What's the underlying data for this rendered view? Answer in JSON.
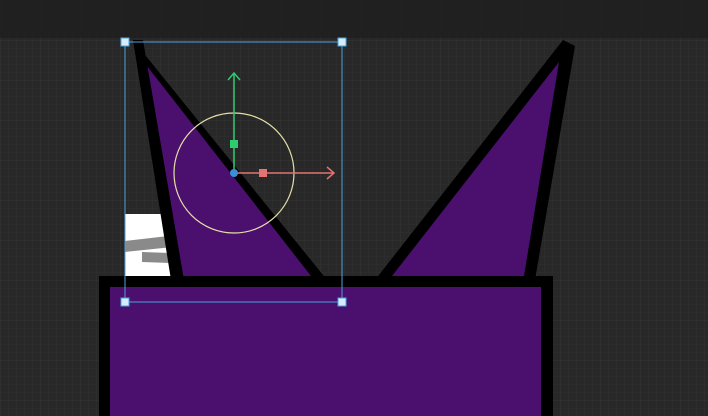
{
  "editor": {
    "canvas_background": "#282828",
    "top_strip_color": "#1e1e1e",
    "grid": {
      "minor_color": "#2f2f2f",
      "major_color": "#363636"
    }
  },
  "artwork": {
    "fill_color": "#4b0f6e",
    "outline_color": "#000000",
    "shapes": [
      "left-ear",
      "right-ear",
      "body-block"
    ],
    "selected_texture": {
      "name": "white-texture-sprite",
      "fill_color": "#ffffff",
      "stripe_color": "#8a8a8a"
    }
  },
  "selection": {
    "rect_color": "#4aa3df",
    "handle_color": "#d6ecff",
    "handles": [
      "top-left",
      "top-right",
      "bottom-left",
      "bottom-right"
    ]
  },
  "gizmo": {
    "rotate_circle_color": "#e6e0a8",
    "y_axis_color": "#2ecc71",
    "x_axis_color": "#e57373",
    "pivot_color": "#3b8fd9",
    "icons": [
      "move-y-arrow-icon",
      "move-x-arrow-icon",
      "rotate-circle-icon",
      "pivot-dot-icon"
    ]
  }
}
